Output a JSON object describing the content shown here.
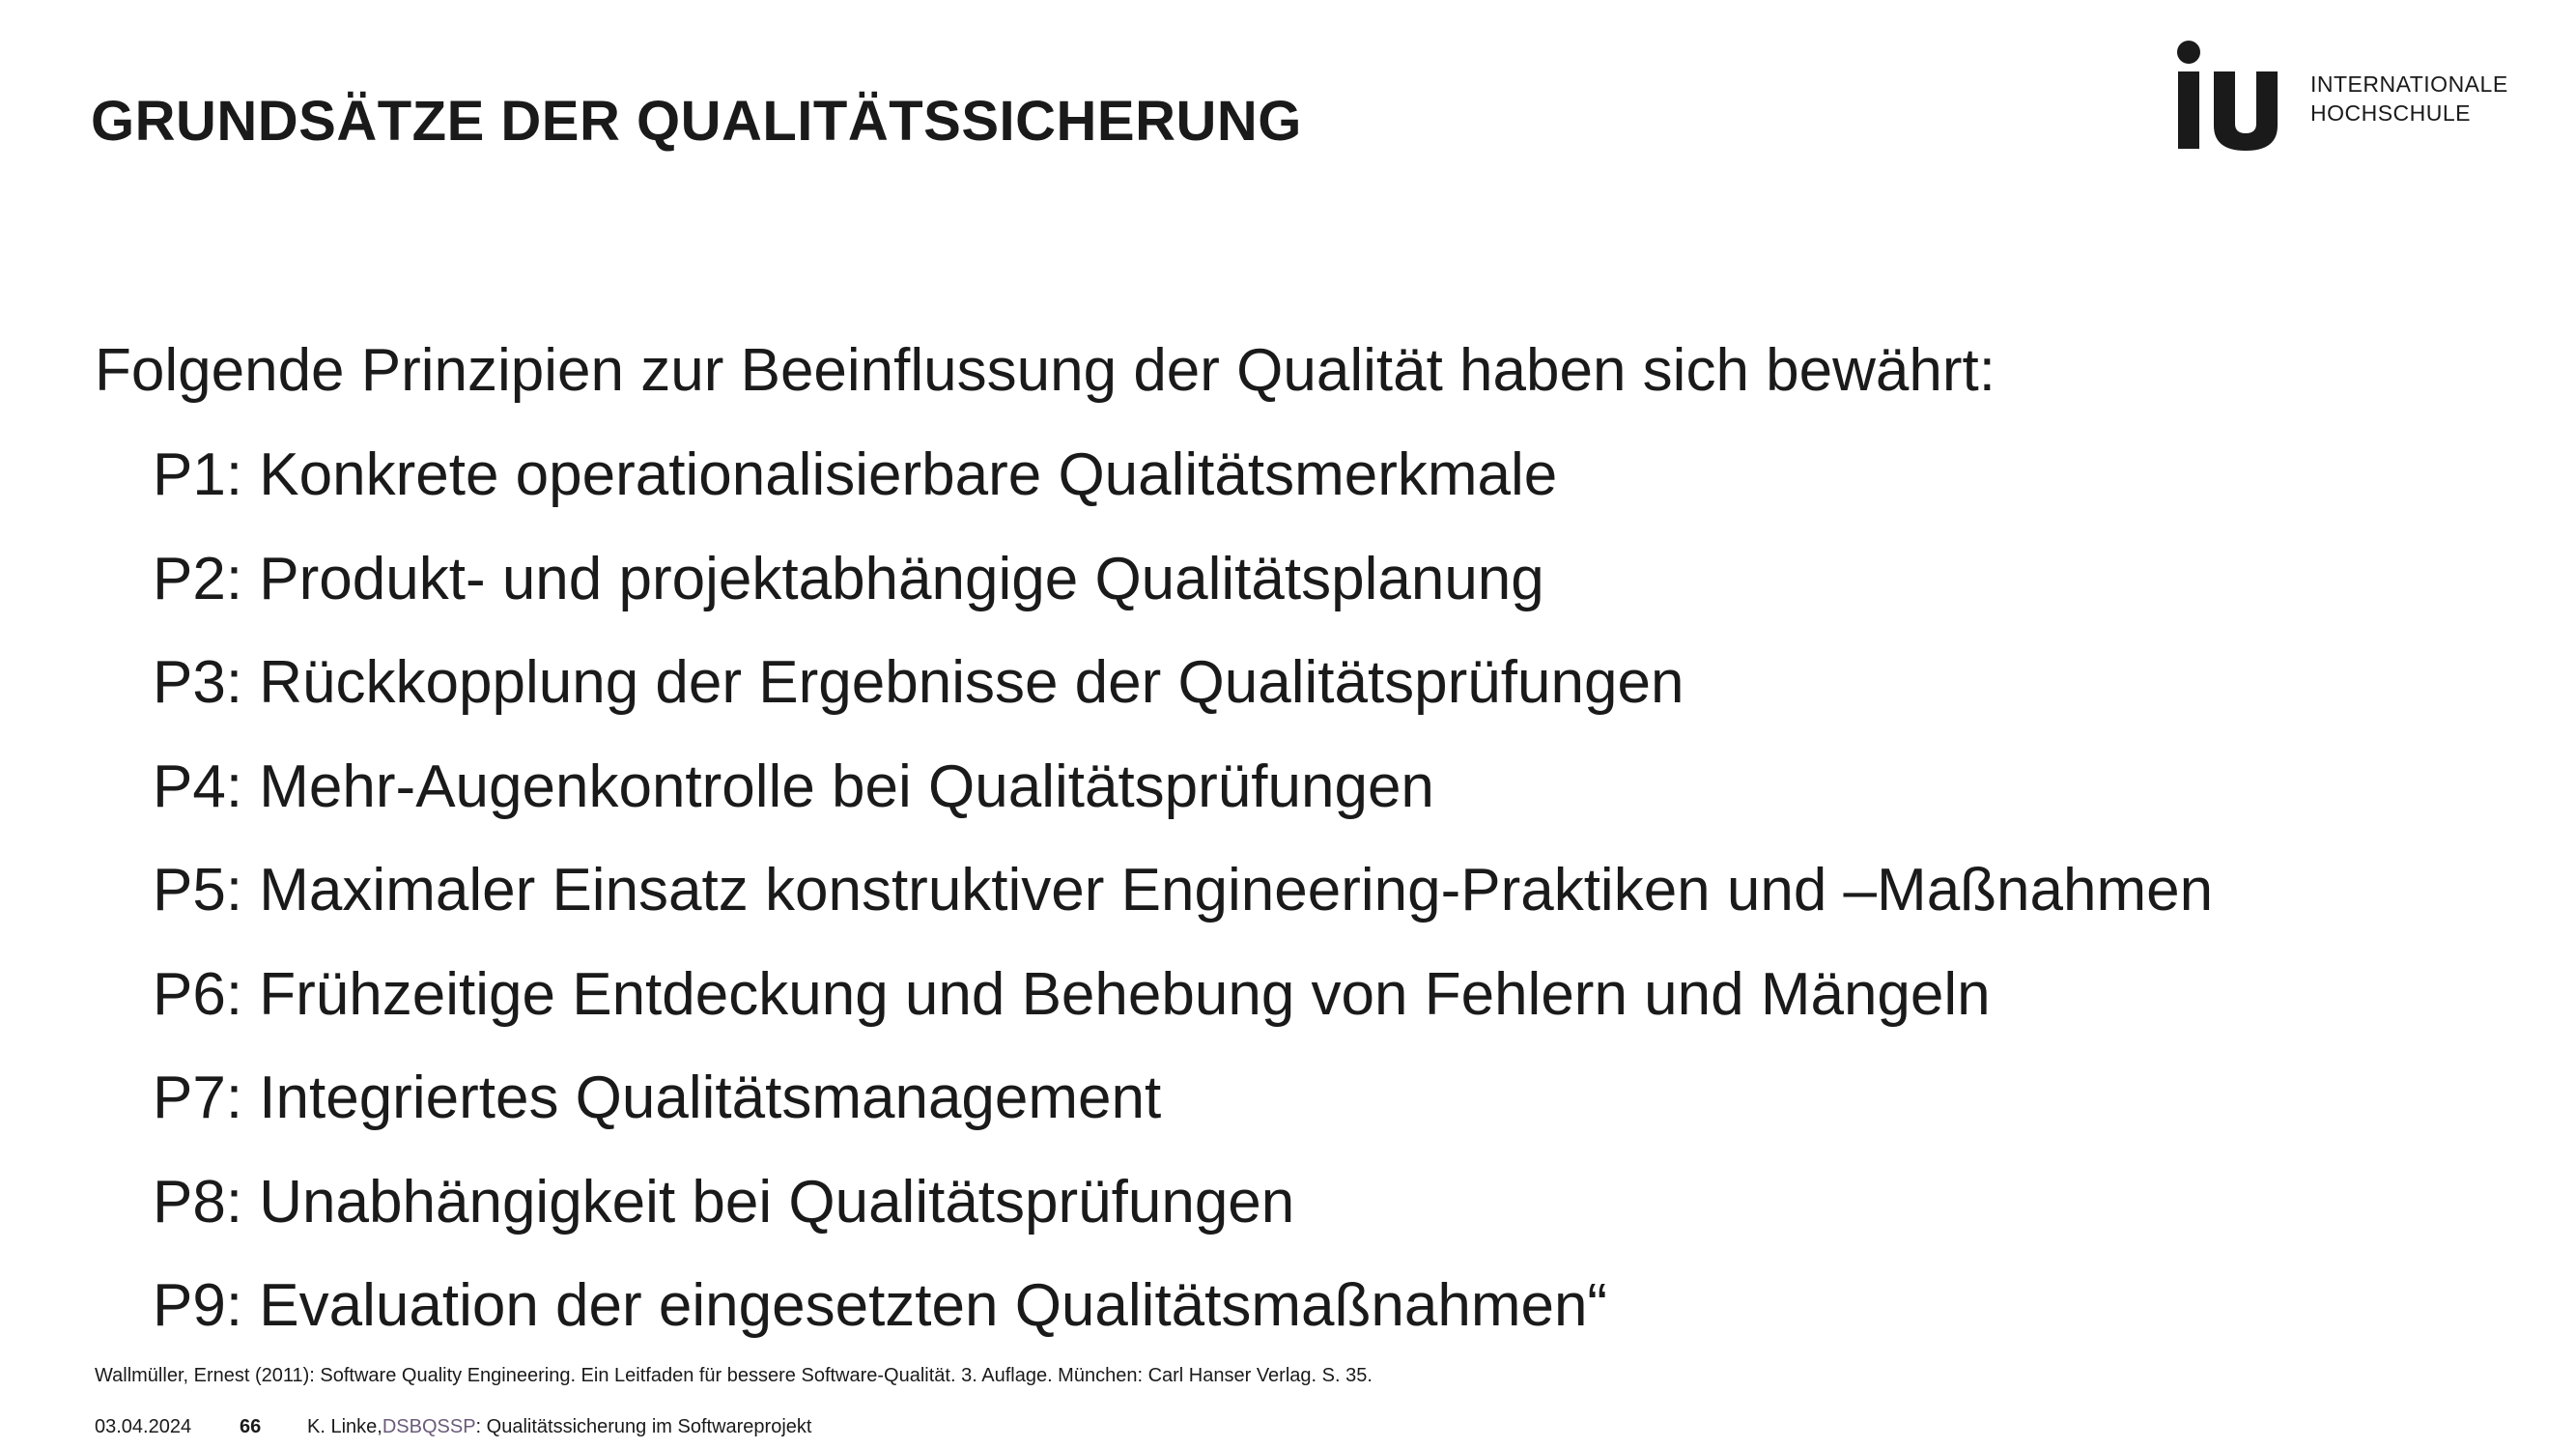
{
  "title": "GRUNDSÄTZE DER QUALITÄTSSICHERUNG",
  "logo": {
    "mark": "iu",
    "line1": "INTERNATIONALE",
    "line2": "HOCHSCHULE"
  },
  "intro": "Folgende Prinzipien zur Beeinflussung der Qualität haben sich bewährt:",
  "principles": [
    "P1: Konkrete operationalisierbare Qualitätsmerkmale",
    "P2: Produkt- und projektabhängige Qualitätsplanung",
    "P3: Rückkopplung der Ergebnisse der Qualitätsprüfungen",
    "P4: Mehr-Augenkontrolle bei Qualitätsprüfungen",
    "P5: Maximaler Einsatz konstruktiver Engineering-Praktiken und –Maßnahmen",
    "P6: Frühzeitige Entdeckung und Behebung von Fehlern und Mängeln",
    "P7: Integriertes Qualitätsmanagement",
    "P8: Unabhängigkeit bei Qualitätsprüfungen",
    "P9: Evaluation der eingesetzten Qualitätsmaßnahmen“"
  ],
  "reference": "Wallmüller, Ernest (2011): Software Quality Engineering. Ein Leitfaden für bessere Software-Qualität. 3. Auflage. München: Carl Hanser Verlag. S. 35.",
  "footer": {
    "date": "03.04.2024",
    "page": "66",
    "author": "K. Linke, ",
    "course_code": "DSBQSSP",
    "course_title": ": Qualitätssicherung im Softwareprojekt"
  },
  "colors": {
    "text": "#1a1a1a",
    "course_code": "#6b5b7a"
  }
}
